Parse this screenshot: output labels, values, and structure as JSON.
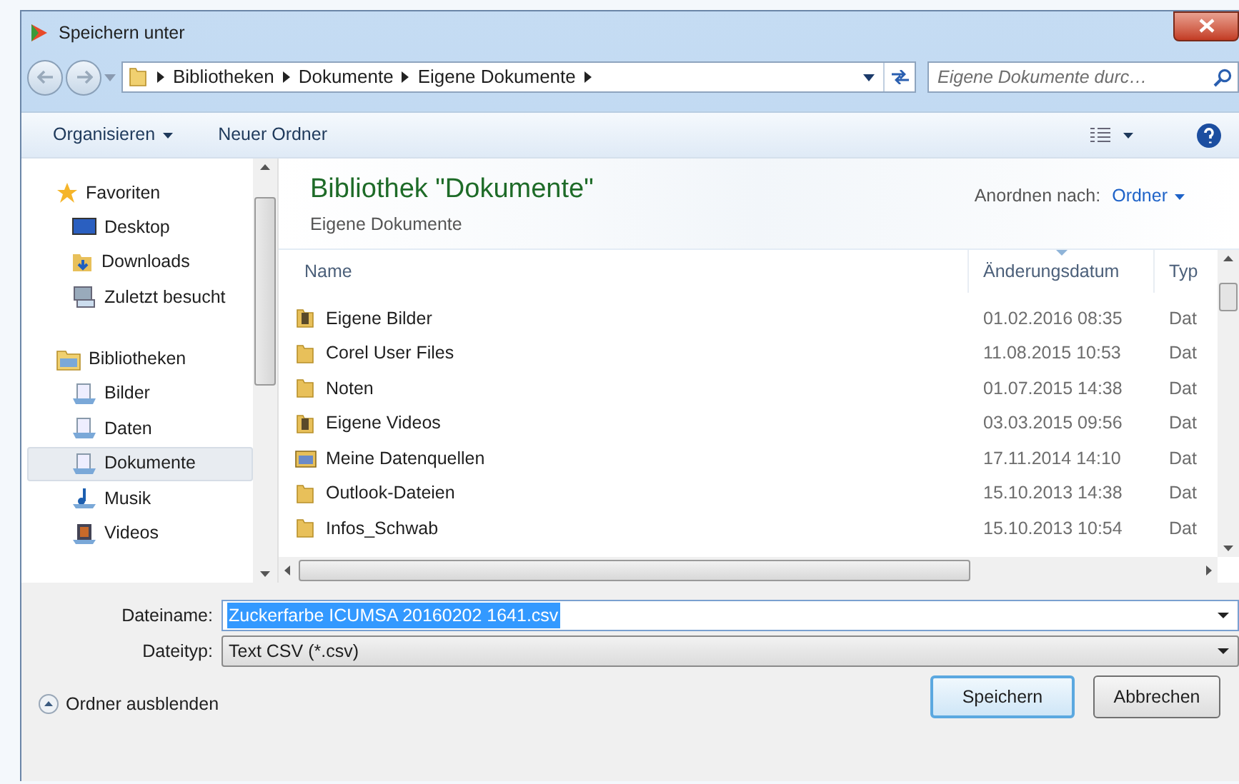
{
  "window": {
    "title": "Speichern unter"
  },
  "address": {
    "crumbs": [
      "Bibliotheken",
      "Dokumente",
      "Eigene Dokumente"
    ]
  },
  "search": {
    "placeholder": "Eigene Dokumente durc…"
  },
  "toolbar": {
    "organize": "Organisieren",
    "new_folder": "Neuer Ordner"
  },
  "sidebar": {
    "groups": [
      {
        "label": "Favoriten",
        "kind": "star",
        "children": [
          {
            "label": "Desktop",
            "kind": "desktop",
            "selected": false
          },
          {
            "label": "Downloads",
            "kind": "downloads",
            "selected": false
          },
          {
            "label": "Zuletzt besucht",
            "kind": "recent",
            "selected": false
          }
        ]
      },
      {
        "label": "Bibliotheken",
        "kind": "library",
        "children": [
          {
            "label": "Bilder",
            "kind": "library-item",
            "selected": false
          },
          {
            "label": "Daten",
            "kind": "library-item",
            "selected": false
          },
          {
            "label": "Dokumente",
            "kind": "library-item",
            "selected": true
          },
          {
            "label": "Musik",
            "kind": "music",
            "selected": false
          },
          {
            "label": "Videos",
            "kind": "videos",
            "selected": false
          }
        ]
      }
    ]
  },
  "library": {
    "title": "Bibliothek \"Dokumente\"",
    "subtitle": "Eigene Dokumente",
    "arrange_label": "Anordnen nach:",
    "arrange_value": "Ordner"
  },
  "table": {
    "columns": [
      {
        "label": "Name",
        "sorted": false
      },
      {
        "label": "Änderungsdatum",
        "sorted": true
      },
      {
        "label": "Typ",
        "sorted": false
      }
    ],
    "rows": [
      {
        "name": "Eigene Bilder",
        "kind": "special",
        "date": "01.02.2016 08:35",
        "type": "Dat"
      },
      {
        "name": "Corel User Files",
        "kind": "folder",
        "date": "11.08.2015 10:53",
        "type": "Dat"
      },
      {
        "name": "Noten",
        "kind": "folder",
        "date": "01.07.2015 14:38",
        "type": "Dat"
      },
      {
        "name": "Eigene Videos",
        "kind": "special",
        "date": "03.03.2015 09:56",
        "type": "Dat"
      },
      {
        "name": "Meine Datenquellen",
        "kind": "datasource",
        "date": "17.11.2014 14:10",
        "type": "Dat"
      },
      {
        "name": "Outlook-Dateien",
        "kind": "folder",
        "date": "15.10.2013 14:38",
        "type": "Dat"
      },
      {
        "name": "Infos_Schwab",
        "kind": "folder",
        "date": "15.10.2013 10:54",
        "type": "Dat"
      }
    ]
  },
  "form": {
    "filename_label": "Dateiname:",
    "filename": "Zuckerfarbe ICUMSA 20160202 1641.csv",
    "filetype_label": "Dateityp:",
    "filetype": "Text CSV (*.csv)"
  },
  "hide_folders": "Ordner ausblenden",
  "buttons": [
    {
      "label": "Speichern",
      "default": true
    },
    {
      "label": "Abbrechen",
      "default": false
    }
  ]
}
